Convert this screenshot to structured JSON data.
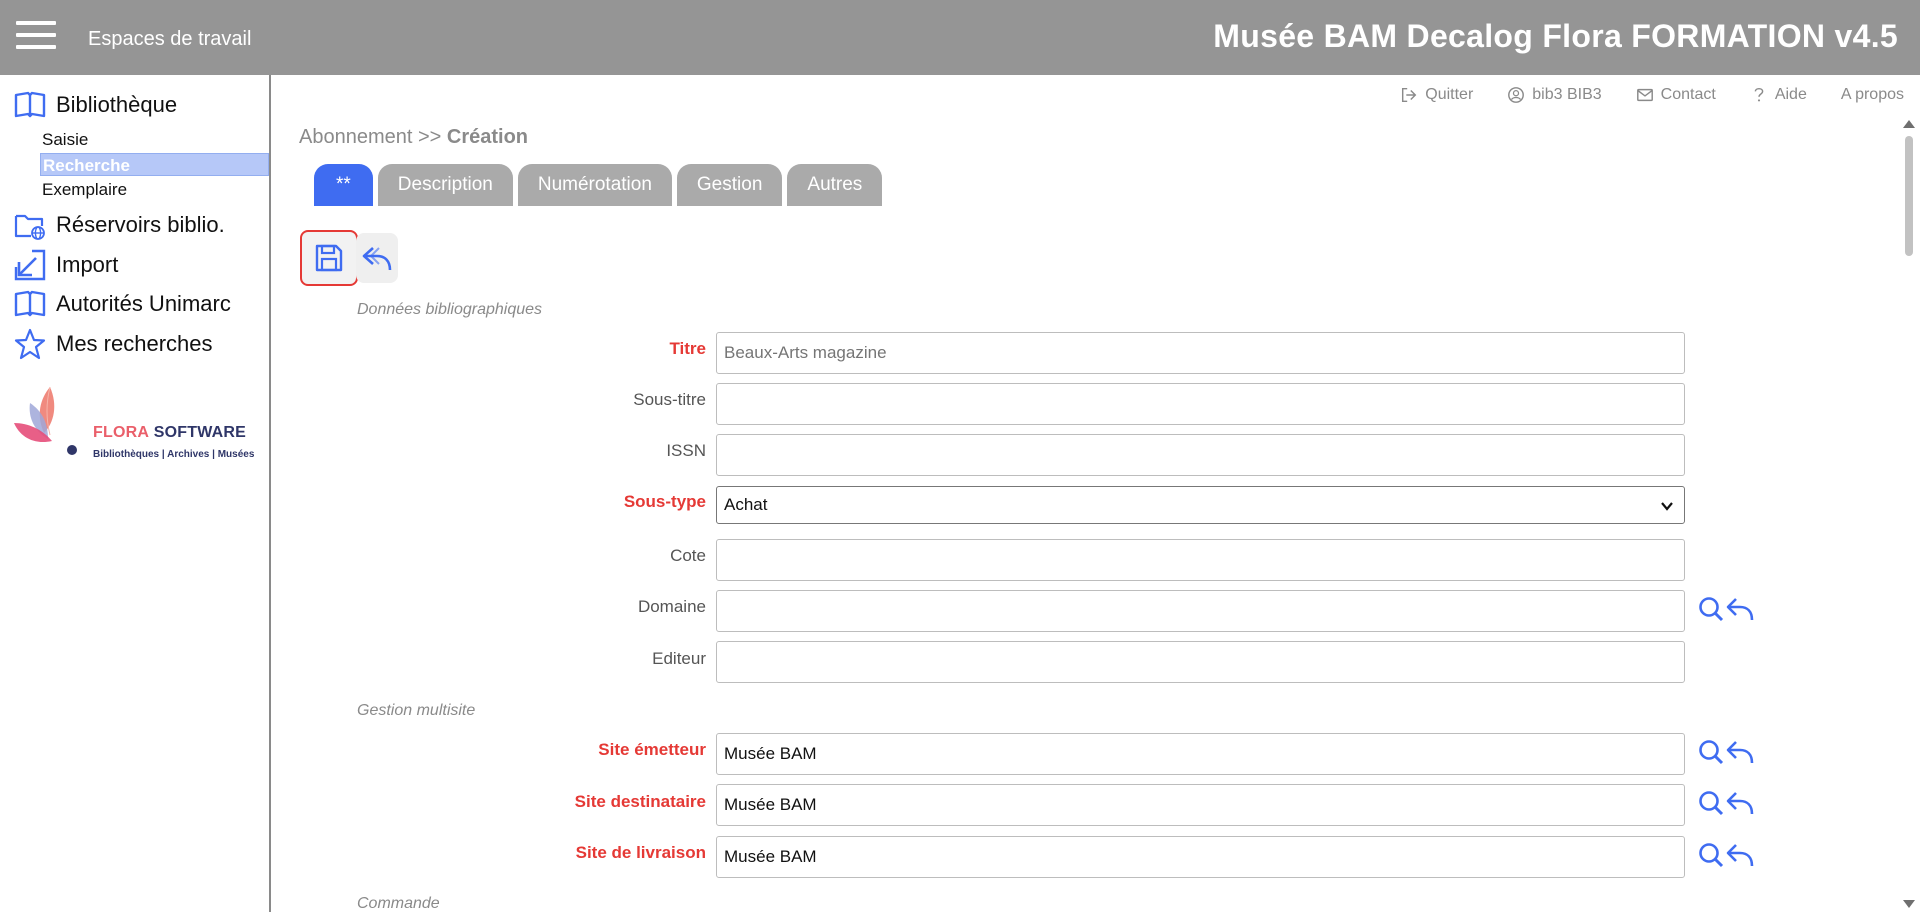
{
  "header": {
    "workspaces_label": "Espaces de travail",
    "app_title": "Musée BAM Decalog Flora FORMATION v4.5"
  },
  "sidebar": {
    "bibliotheque": "Bibliothèque",
    "sub_items": [
      "Saisie",
      "Recherche",
      "Exemplaire"
    ],
    "active_sub_item": "Recherche",
    "reservoirs": "Réservoirs biblio.",
    "import": "Import",
    "autorites": "Autorités Unimarc",
    "mes_recherches": "Mes recherches",
    "logo": {
      "flora": "FLORA",
      "software": "SOFTWARE",
      "tagline": "Bibliothèques | Archives | Musées"
    }
  },
  "toplinks": {
    "quit": "Quitter",
    "user": "bib3 BIB3",
    "contact": "Contact",
    "help": "Aide",
    "about": "A propos"
  },
  "breadcrumb": {
    "prefix": "Abonnement >> ",
    "current": "Création"
  },
  "tabs": [
    "**",
    "Description",
    "Numérotation",
    "Gestion",
    "Autres"
  ],
  "active_tab": "**",
  "sections": {
    "biblio": "Données bibliographiques",
    "multisite": "Gestion multisite",
    "commande": "Commande"
  },
  "fields": {
    "titre": {
      "label": "Titre",
      "value": "",
      "placeholder": "Beaux-Arts magazine"
    },
    "sous_titre": {
      "label": "Sous-titre",
      "value": ""
    },
    "issn": {
      "label": "ISSN",
      "value": ""
    },
    "sous_type": {
      "label": "Sous-type",
      "value": "Achat"
    },
    "cote": {
      "label": "Cote",
      "value": ""
    },
    "domaine": {
      "label": "Domaine",
      "value": ""
    },
    "editeur": {
      "label": "Editeur",
      "value": ""
    },
    "site_emetteur": {
      "label": "Site émetteur",
      "value": "Musée BAM"
    },
    "site_destinataire": {
      "label": "Site destinataire",
      "value": "Musée BAM"
    },
    "site_livraison": {
      "label": "Site de livraison",
      "value": "Musée BAM"
    }
  },
  "colors": {
    "accent": "#3f6cf1",
    "required": "#e53935",
    "topbar": "#959595",
    "tab_inactive": "#aaaaaa"
  }
}
